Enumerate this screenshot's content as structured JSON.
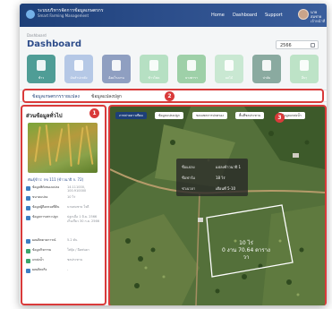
{
  "app": {
    "brand_line1": "ระบบบริหารจัดการข้อมูลเกษตรกร",
    "brand_line2": "Smart Farming Management",
    "nav": [
      "Home",
      "Dashboard",
      "Support"
    ],
    "user_name": "นายสมชาย",
    "user_role": "เจ้าหน้าที่"
  },
  "page": {
    "breadcrumb": "Dashboard",
    "title": "Dashboard",
    "year": "2566"
  },
  "categories": [
    {
      "label": "ข้าว",
      "color": "#4f9d96"
    },
    {
      "label": "มันสำปะหลัง",
      "color": "#b5c8e6"
    },
    {
      "label": "อ้อยโรงงาน",
      "color": "#8f9fc1"
    },
    {
      "label": "ข้าวโพด",
      "color": "#b6e0c3"
    },
    {
      "label": "ยางพารา",
      "color": "#9ed0a8"
    },
    {
      "label": "ผลไม้",
      "color": "#c9e8d2"
    },
    {
      "label": "ปาล์ม",
      "color": "#8aaaa0"
    },
    {
      "label": "อื่นๆ",
      "color": "#bde3c7"
    }
  ],
  "tabs": [
    "ข้อมูลเกษตรกรรายแปลง",
    "ข้อมูลแปลงปลูก"
  ],
  "annotations": [
    "1",
    "2",
    "3"
  ],
  "left_panel": {
    "title": "ส่วนข้อมูลทั่วไป",
    "variety": "พันธุ์ข้าว: กข 111 (ข้าวนาปี ก. 72)",
    "rows": [
      {
        "key": "ข้อมูลพิกัดของแปลง",
        "value": "14.111000, 100.910000",
        "value2": ""
      },
      {
        "key": "ขนาดแปลง",
        "value": "10 ไร่",
        "value2": ""
      },
      {
        "key": "ข้อมูลผู้ถือครองที่ดิน",
        "value": "นายสมชาย ใจดี",
        "value2": ""
      },
      {
        "key": "ข้อมูลการเพาะปลูก",
        "value": "ปลูกเมื่อ 1 มิ.ย. 2566",
        "value2": "เก็บเกี่ยว 30 ก.ย. 2566"
      },
      {
        "key": "ผลผลิตคาดการณ์",
        "value": "5.2 ตัน",
        "value2": ""
      },
      {
        "key": "ข้อมูลกิจกรรม",
        "value": "ใส่ปุ๋ย / ฉีดพ่นยา",
        "value2": ""
      },
      {
        "key": "แหล่งน้ำ",
        "value": "ชลประทาน",
        "value2": ""
      },
      {
        "key": "ผลผลิตจริง",
        "value": "-",
        "value2": ""
      }
    ]
  },
  "map": {
    "layers": [
      "ภาพถ่ายดาวเทียม",
      "ข้อมูลแปลงปลูก",
      "ขอบเขตการปกครอง",
      "พื้นที่ชลประทาน",
      "ข้อมูลแหล่งน้ำ"
    ],
    "popup": [
      {
        "key": "ชื่อแปลง",
        "value": "แปลงข้าวนาปี 1"
      },
      {
        "key": "ชื่อฟาร์ม",
        "value": "18 ไร่"
      },
      {
        "key": "ช่วงเวลา",
        "value": "เดือนที่ 5-10"
      }
    ],
    "parcel_rai": "10 ไร่",
    "parcel_area": "0 งาน 70.64 ตารางวา"
  }
}
